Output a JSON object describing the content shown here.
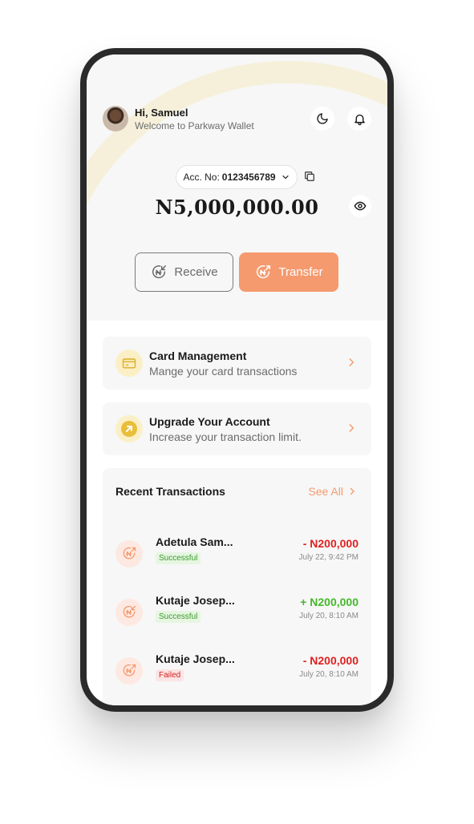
{
  "header": {
    "greeting": "Hi, Samuel",
    "welcome": "Welcome to Parkway Wallet",
    "icons": [
      "moon-icon",
      "bell-icon"
    ]
  },
  "account": {
    "label": "Acc. No:",
    "number": "0123456789",
    "balance": "N5,000,000.00"
  },
  "actions": {
    "receive_label": "Receive",
    "transfer_label": "Transfer"
  },
  "cards": [
    {
      "title": "Card Management",
      "subtitle": "Mange your card transactions",
      "icon": "credit-card-icon"
    },
    {
      "title": "Upgrade Your Account",
      "subtitle": "Increase your transaction limit.",
      "icon": "arrow-up-right-icon"
    }
  ],
  "recent": {
    "title": "Recent Transactions",
    "see_all": "See All",
    "items": [
      {
        "name": "Adetula Sam...",
        "status": "Successful",
        "amount": "- N200,000",
        "date": "July 22, 9:42 PM",
        "direction": "out"
      },
      {
        "name": "Kutaje Josep...",
        "status": "Successful",
        "amount": "+ N200,000",
        "date": "July 20, 8:10 AM",
        "direction": "in"
      },
      {
        "name": "Kutaje Josep...",
        "status": "Failed",
        "amount": "- N200,000",
        "date": "July 20, 8:10 AM",
        "direction": "out"
      }
    ]
  },
  "colors": {
    "accent": "#f59a6e",
    "success": "#45b82a",
    "danger": "#e02020",
    "card_icon_bg": "#fbefc6"
  }
}
